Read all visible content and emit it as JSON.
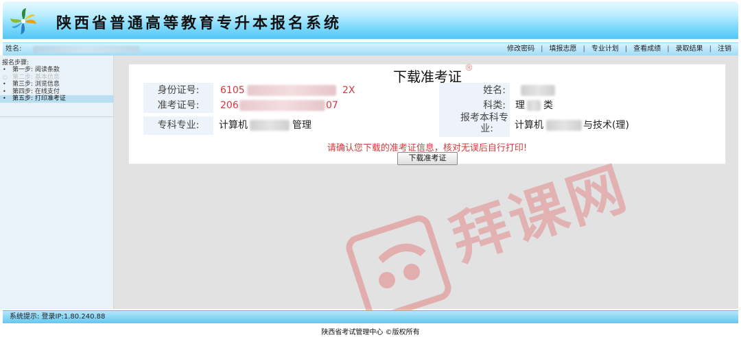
{
  "header": {
    "title": "陕西省普通高等教育专升本报名系统"
  },
  "topbar": {
    "user_label": "姓名:",
    "nav": [
      "修改密码",
      "填报志愿",
      "专业计划",
      "查看成绩",
      "录取结果",
      "注销"
    ],
    "separator": "|"
  },
  "sidebar": {
    "title": "报名步骤:",
    "steps": [
      {
        "label": "第一步: 阅读条款",
        "bullet": "•"
      },
      {
        "label": "第二步: 基本信息",
        "bullet": "○"
      },
      {
        "label": "第三步: 浏览信息",
        "bullet": "•"
      },
      {
        "label": "第四步: 在线支付",
        "bullet": "•"
      },
      {
        "label": "第五步: 打印准考证",
        "bullet": "•"
      }
    ]
  },
  "card": {
    "title": "下载准考证",
    "reg_mark": "®",
    "fields": {
      "id_label": "身份证号:",
      "id_prefix": "6105",
      "id_suffix": "2X",
      "exam_label": "准考证号:",
      "exam_prefix": "206",
      "exam_suffix": "07",
      "name_label": "姓名:",
      "category_label": "科类:",
      "category_prefix": "理",
      "category_suffix": "类",
      "junior_major_label": "专科专业:",
      "junior_major_prefix": "计算机",
      "junior_major_suffix": "管理",
      "target_major_label_line1": "报考本科专",
      "target_major_label_line2": "业:",
      "target_major_prefix": "计算机",
      "target_major_suffix": "与技术(理)"
    },
    "notice": "请确认您下载的准考证信息，核对无误后自行打印!",
    "download_button": "下载准考证"
  },
  "watermark": {
    "text": "拜课网",
    "color": "#e26e6e"
  },
  "footer": {
    "system_tip": "系统提示: 登录IP:1.80.240.88",
    "copyright": "陕西省考试管理中心 ©版权所有"
  }
}
